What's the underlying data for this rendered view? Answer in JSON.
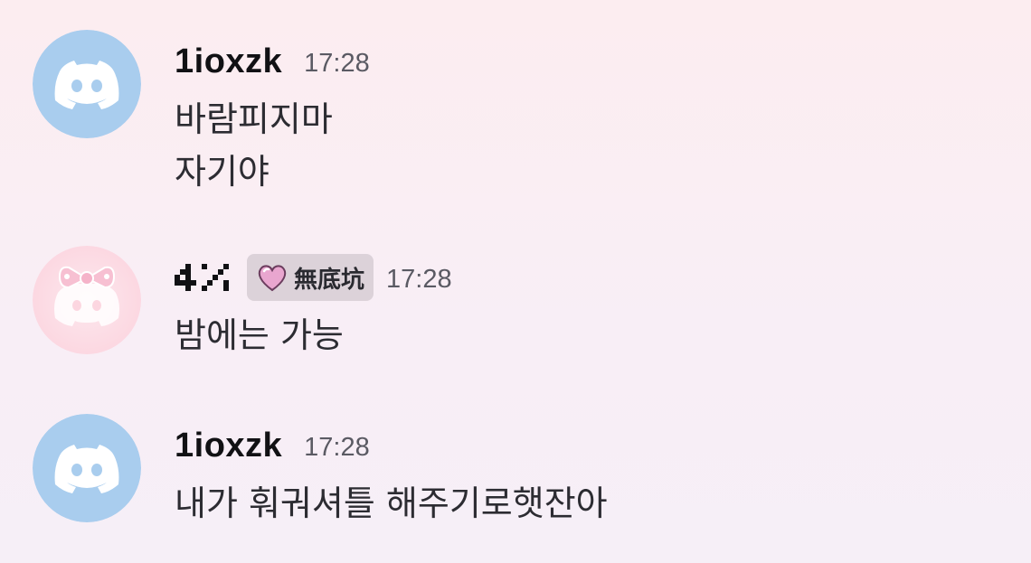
{
  "messages": [
    {
      "username": "1ioxzk",
      "timestamp": "17:28",
      "avatar_icon": "discord-default-avatar-blue",
      "lines": [
        "바람피지마",
        "자기야"
      ]
    },
    {
      "username": "4%",
      "tag_icon": "pink-heart-icon",
      "tag_label": "無底坑",
      "timestamp": "17:28",
      "avatar_icon": "pink-bow-avatar",
      "lines": [
        "밤에는 가능"
      ]
    },
    {
      "username": "1ioxzk",
      "timestamp": "17:28",
      "avatar_icon": "discord-default-avatar-blue",
      "lines": [
        "내가 훠궈셔틀 해주기로햇잔아"
      ]
    }
  ],
  "colors": {
    "background": "#fcedf0",
    "avatar_blue": "#a9cdee",
    "avatar_pink": "#fcdbe3",
    "tag_bg": "#dcd2d9",
    "heart": "#e9a6cf"
  }
}
